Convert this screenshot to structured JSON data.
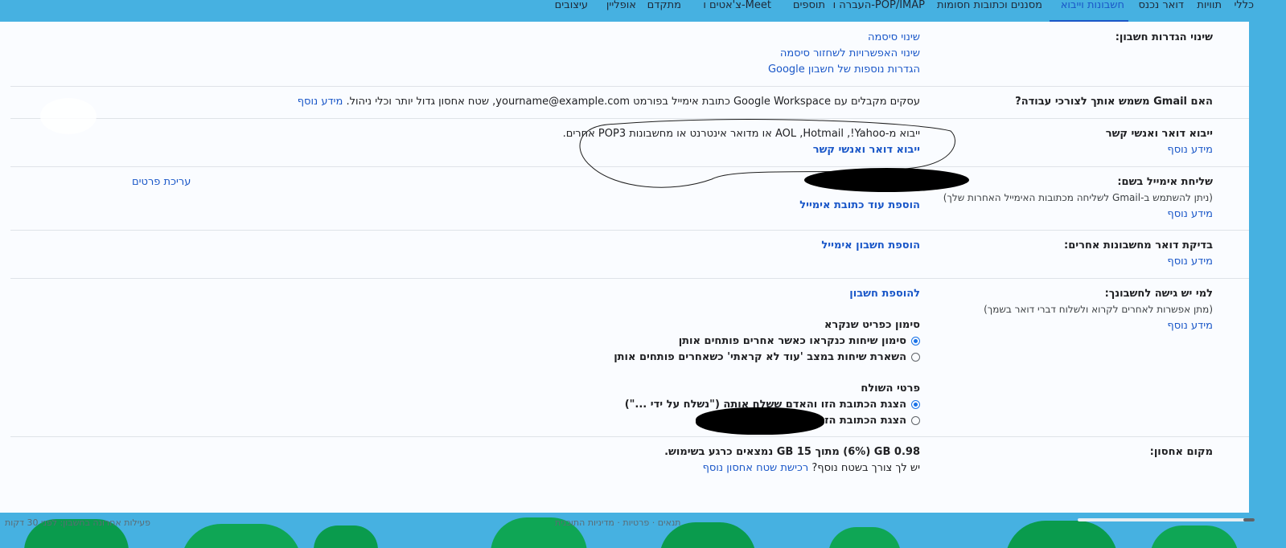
{
  "tabs": [
    {
      "label": "כללי"
    },
    {
      "label": "תוויות"
    },
    {
      "label": "דואר נכנס"
    },
    {
      "label": "חשבונות וייבוא"
    },
    {
      "label": "מסננים וכתובות חסומות"
    },
    {
      "label": "העברה ו-POP/IMAP"
    },
    {
      "label": "תוספים"
    },
    {
      "label": "צ'אטים ו-Meet"
    },
    {
      "label": "מתקדם"
    },
    {
      "label": "אופליין"
    },
    {
      "label": "עיצובים"
    }
  ],
  "settings": {
    "change_account": {
      "label": "שינוי הגדרות חשבון:",
      "links": [
        "שינוי סיסמה",
        "שינוי האפשרויות לשחזור סיסמה",
        "הגדרות נוספות של חשבון Google"
      ]
    },
    "gmail_for_work": {
      "label": "האם Gmail משמש אותך לצורכי עבודה?",
      "text": "עסקים מקבלים עם Google Workspace כתובת אימייל בפורמט yourname@example.com, שטח אחסון גדול יותר וכלי ניהול.",
      "more": "מידע נוסף"
    },
    "import": {
      "label": "ייבוא דואר ואנשי קשר",
      "more": "מידע נוסף",
      "text": "ייבוא מ-Yahoo!‏, Hotmail‏, AOL או מדואר אינטרנט או מחשבונות POP3 אחרים.",
      "action": "ייבוא דואר ואנשי קשר"
    },
    "send_as": {
      "label": "שליחת אימייל בשם:",
      "sub": "(ניתן להשתמש ב-Gmail לשליחה מכתובות האימייל האחרות שלך)",
      "more": "מידע נוסף",
      "edit": "עריכת פרטים",
      "add": "הוספת עוד כתובת אימייל"
    },
    "check_mail": {
      "label": "בדיקת דואר מחשבונות אחרים:",
      "more": "מידע נוסף",
      "add": "הוספת חשבון אימייל"
    },
    "grant_access": {
      "label": "למי יש גישה לחשבונך:",
      "sub": "(מתן אפשרות לאחרים לקרוא ולשלוח דברי דואר בשמך)",
      "more": "מידע נוסף",
      "add": "להוספת חשבון",
      "mark_heading": "סימון כפריט שנקרא",
      "mark_options": [
        {
          "label": "סימון שיחות כנקראו כאשר אחרים פותחים אותן",
          "checked": true
        },
        {
          "label": "השארת שיחות במצב 'עוד לא קראתי' כשאחרים פותחים אותן",
          "checked": false
        }
      ],
      "sender_heading": "פרטי השולח",
      "sender_options": [
        {
          "label": "הצגת הכתובת הזו והאדם ששלח אותה (\"נשלח על ידי ...\")",
          "checked": true
        },
        {
          "label": "הצגת הכתובת הזו בלבד (",
          "checked": false
        }
      ]
    },
    "storage": {
      "label": "מקום אחסון:",
      "usage": "0.98 GB‏ (6%) מתוך 15 GB נמצאים כרגע בשימוש.",
      "need_more": "יש לך צורך בשטח נוסף?",
      "buy": "רכישת שטח אחסון נוסף"
    }
  },
  "footer": {
    "left": "פעילות אחרונה בחשבון: לפני 30 דקות",
    "center": "תנאים · פרטיות · מדיניות התוכנית"
  }
}
